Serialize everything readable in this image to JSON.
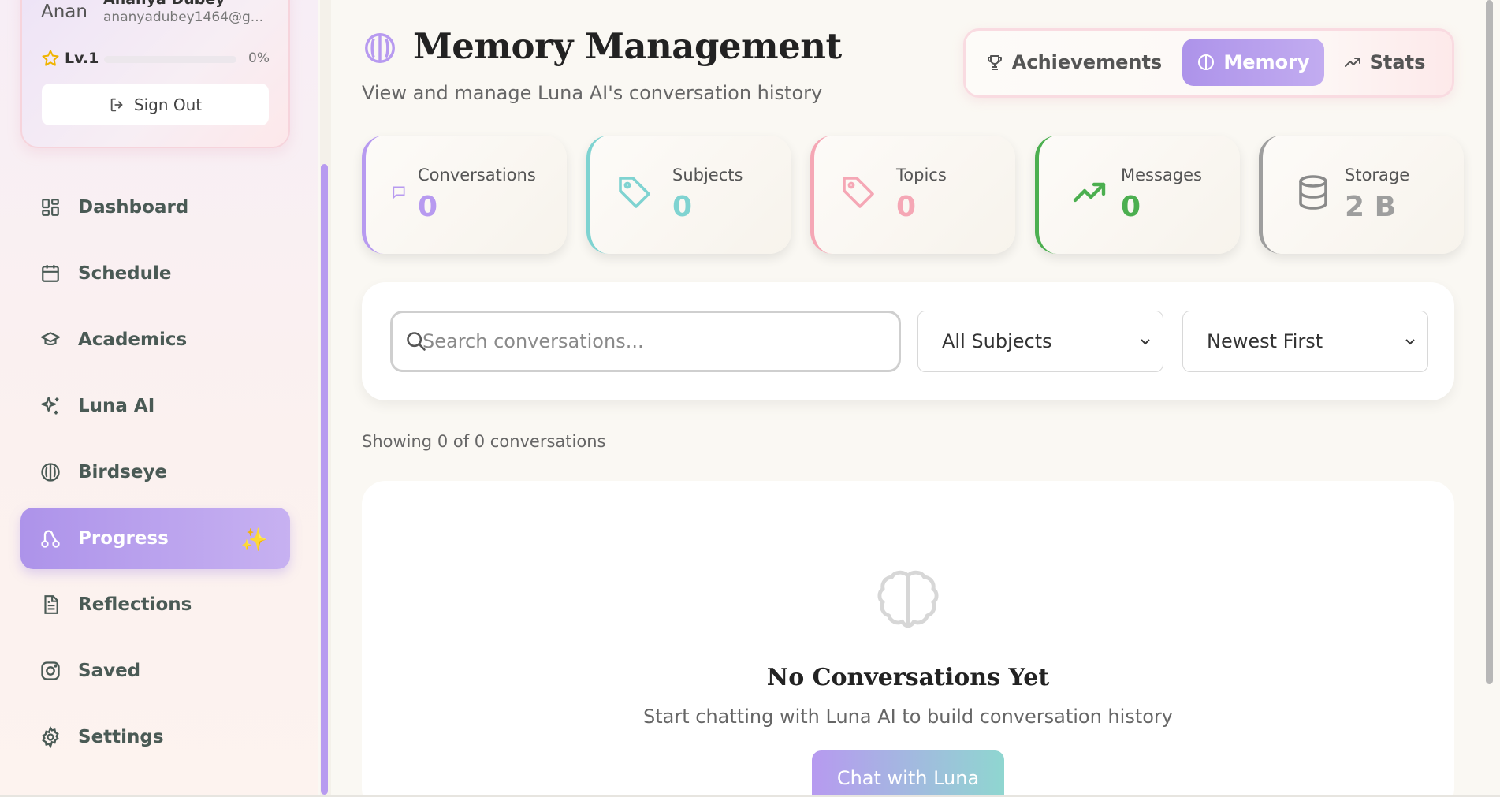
{
  "user": {
    "name": "Ananya Dubey",
    "avatar_text": "Anan",
    "email": "ananyadubey1464@g...",
    "level_label": "Lv.1",
    "level_percent_text": "0%",
    "level_progress": 0,
    "sign_out_label": "Sign Out"
  },
  "nav": {
    "items": [
      {
        "label": "Dashboard",
        "icon": "dashboard-icon"
      },
      {
        "label": "Schedule",
        "icon": "calendar-icon"
      },
      {
        "label": "Academics",
        "icon": "graduation-cap-icon"
      },
      {
        "label": "Luna AI",
        "icon": "sparkles-icon"
      },
      {
        "label": "Birdseye",
        "icon": "brain-icon"
      },
      {
        "label": "Progress",
        "icon": "progress-icon",
        "active": true,
        "badge": "✨"
      },
      {
        "label": "Reflections",
        "icon": "document-icon"
      },
      {
        "label": "Saved",
        "icon": "instagram-icon"
      },
      {
        "label": "Settings",
        "icon": "gear-icon"
      }
    ]
  },
  "header": {
    "title": "Memory Management",
    "subtitle": "View and manage Luna AI's conversation history"
  },
  "tabs": [
    {
      "label": "Achievements",
      "icon": "trophy-icon",
      "active": false
    },
    {
      "label": "Memory",
      "icon": "brain-icon",
      "active": true
    },
    {
      "label": "Stats",
      "icon": "trending-up-icon",
      "active": false
    }
  ],
  "stats": [
    {
      "label": "Conversations",
      "value": "0",
      "color": "#b79af0",
      "icon": "message-icon"
    },
    {
      "label": "Subjects",
      "value": "0",
      "color": "#7fd3d1",
      "icon": "tag-icon"
    },
    {
      "label": "Topics",
      "value": "0",
      "color": "#f5a7b5",
      "icon": "tag-icon"
    },
    {
      "label": "Messages",
      "value": "0",
      "color": "#4caf50",
      "icon": "trending-up-icon"
    },
    {
      "label": "Storage",
      "value": "2 B",
      "color": "#9e9e9e",
      "icon": "database-icon"
    }
  ],
  "filters": {
    "search_placeholder": "Search conversations...",
    "subject_select": "All Subjects",
    "sort_select": "Newest First"
  },
  "showing_text": "Showing 0 of 0 conversations",
  "empty_state": {
    "title": "No Conversations Yet",
    "subtitle": "Start chatting with Luna AI to build conversation history",
    "button_label": "Chat with Luna"
  },
  "colors": {
    "accent": "#b79af0",
    "teal": "#7fd3d1",
    "pink": "#f5a7b5",
    "green": "#4caf50",
    "gray": "#9e9e9e"
  }
}
